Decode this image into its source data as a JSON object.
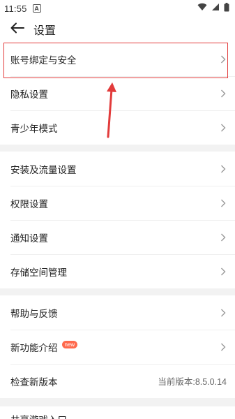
{
  "status_bar": {
    "time": "11:55",
    "notification_icon": "a-icon",
    "wifi_icon": "wifi-icon",
    "signal_icon": "signal-icon",
    "battery_icon": "battery-icon"
  },
  "header": {
    "back_icon": "arrow-left-icon",
    "title": "设置"
  },
  "groups": [
    {
      "items": [
        {
          "label": "账号绑定与安全",
          "highlighted": true
        },
        {
          "label": "隐私设置"
        },
        {
          "label": "青少年模式"
        }
      ]
    },
    {
      "items": [
        {
          "label": "安装及流量设置"
        },
        {
          "label": "权限设置"
        },
        {
          "label": "通知设置"
        },
        {
          "label": "存储空间管理"
        }
      ]
    },
    {
      "items": [
        {
          "label": "帮助与反馈"
        },
        {
          "label": "新功能介绍",
          "badge": "new"
        },
        {
          "label": "检查新版本",
          "value": "当前版本:8.5.0.14"
        }
      ]
    }
  ],
  "partial_item": {
    "label": "共享游戏入口"
  },
  "annotation": {
    "highlight_color": "#e23b3b",
    "arrow_color": "#e23b3b"
  }
}
